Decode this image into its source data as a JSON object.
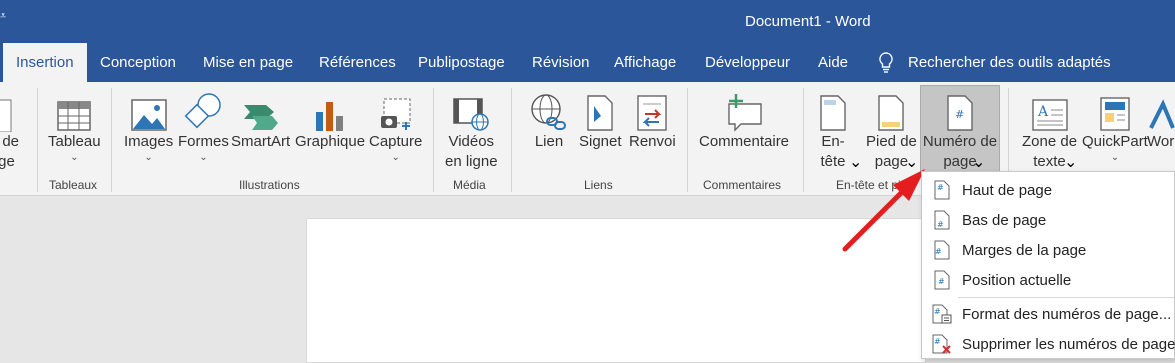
{
  "window": {
    "title": "Document1  -  Word",
    "qat_glyph": "⩡"
  },
  "tabs": [
    "Insertion",
    "Conception",
    "Mise en page",
    "Références",
    "Publipostage",
    "Révision",
    "Affichage",
    "Développeur",
    "Aide"
  ],
  "tell_me": "Rechercher des outils adaptés",
  "ribbon": {
    "partial_left": {
      "line1": "t de",
      "line2": "ge"
    },
    "tableau": {
      "label": "Tableau",
      "group": "Tableaux"
    },
    "illustrations": {
      "group": "Illustrations",
      "images": "Images",
      "formes": "Formes",
      "smartart": "SmartArt",
      "graphique": "Graphique",
      "capture": "Capture"
    },
    "media": {
      "group": "Média",
      "line1": "Vidéos",
      "line2": "en ligne"
    },
    "liens": {
      "group": "Liens",
      "lien": "Lien",
      "signet": "Signet",
      "renvoi": "Renvoi"
    },
    "commentaires": {
      "group": "Commentaires",
      "commentaire": "Commentaire"
    },
    "entete": {
      "group": "En-tête et pi",
      "entete_line1": "En-",
      "entete_line2": "tête",
      "pied_line1": "Pied de",
      "pied_line2": "page",
      "numero_line1": "Numéro de",
      "numero_line2": "page"
    },
    "texte": {
      "zone_line1": "Zone de",
      "zone_line2": "texte",
      "quickpart": "QuickPart",
      "wordart": "Wor"
    }
  },
  "dropdown": {
    "items": [
      {
        "label": "Haut de page",
        "icon": "page-number-top-icon"
      },
      {
        "label": "Bas de page",
        "icon": "page-number-bottom-icon"
      },
      {
        "label": "Marges de la page",
        "icon": "page-number-margin-icon"
      },
      {
        "label": "Position actuelle",
        "icon": "page-number-current-icon"
      },
      {
        "label": "Format des numéros de page...",
        "icon": "format-page-number-icon"
      },
      {
        "label": "Supprimer les numéros de page",
        "icon": "remove-page-number-icon"
      }
    ]
  },
  "colors": {
    "title_bar": "#2b579a",
    "ribbon_bg": "#f3f3f3",
    "selected_btn": "#c5c5c5",
    "arrow": "#e41e1e"
  }
}
